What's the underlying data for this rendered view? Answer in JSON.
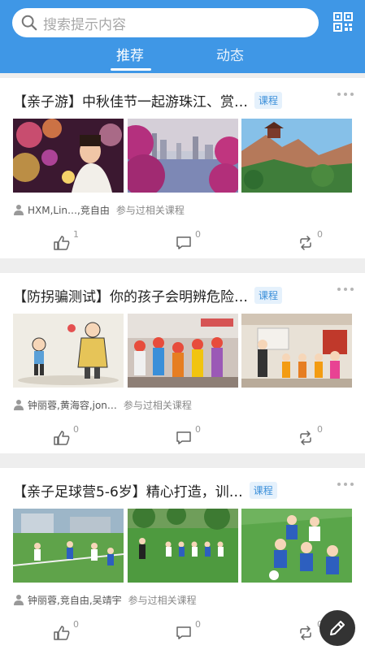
{
  "search": {
    "placeholder": "搜索提示内容"
  },
  "tabs": [
    {
      "label": "推荐",
      "active": true
    },
    {
      "label": "动态",
      "active": false
    }
  ],
  "colors": {
    "header": "#3f97e6",
    "badge_bg": "#e5f1fc",
    "badge_text": "#3a8fd9"
  },
  "posts": [
    {
      "title": "【亲子游】中秋佳节一起游珠江、赏…",
      "badge": "课程",
      "participants": "HXM,Lin…,竞自由",
      "relation": "参与过相关课程",
      "likes": "1",
      "comments": "0",
      "shares": "0"
    },
    {
      "title": "【防拐骗测试】你的孩子会明辨危险…",
      "badge": "课程",
      "participants": "钟丽蓉,黄海容,jon…",
      "relation": "参与过相关课程",
      "likes": "0",
      "comments": "0",
      "shares": "0"
    },
    {
      "title": "【亲子足球营5-6岁】精心打造，训…",
      "badge": "课程",
      "participants": "钟丽蓉,竞自由,吴靖宇",
      "relation": "参与过相关课程",
      "likes": "0",
      "comments": "0",
      "shares": "0"
    }
  ],
  "icons": [
    "search-icon",
    "qr-code-icon",
    "user-icon",
    "like-icon",
    "comment-icon",
    "share-icon",
    "edit-icon"
  ]
}
